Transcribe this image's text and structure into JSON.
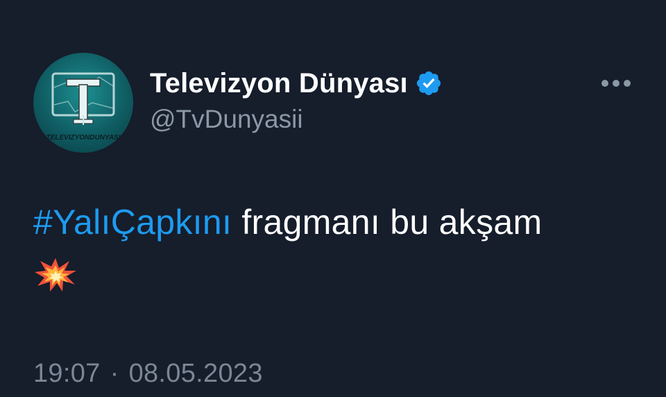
{
  "user": {
    "display_name": "Televizyon Dünyası",
    "handle": "@TvDunyasii",
    "verified": true,
    "avatar_caption": "TELEVIZYONDUNYASI"
  },
  "tweet": {
    "hashtag": "#YalıÇapkını",
    "text": " fragmanı bu akşam",
    "emoji": "collision-emoji"
  },
  "meta": {
    "time": "19:07",
    "separator": "·",
    "date": "08.05.2023"
  },
  "icons": {
    "more": "more-horizontal-icon",
    "verified": "verified-badge-icon"
  },
  "colors": {
    "background": "#161d2b",
    "hashtag": "#1d9bf0",
    "secondary_text": "#8b98a5",
    "verified_badge": "#1d9bf0"
  }
}
